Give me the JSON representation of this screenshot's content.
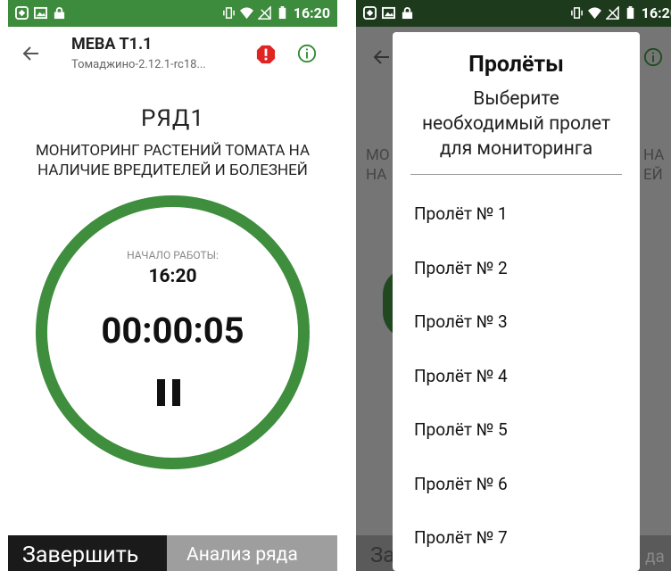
{
  "status_bar": {
    "time": "16:20"
  },
  "app": {
    "title": "МЕВА Т1.1",
    "subtitle": "Томаджино-2.12.1-rc18..."
  },
  "main": {
    "row_title": "РЯД1",
    "description_line1": "МОНИТОРИНГ РАСТЕНИЙ ТОМАТА НА",
    "description_line2": "НАЛИЧИЕ ВРЕДИТЕЛЕЙ И БОЛЕЗНЕЙ",
    "start_label": "НАЧАЛО РАБОТЫ:",
    "start_time": "16:20",
    "elapsed": "00:00:05"
  },
  "bottom_bar": {
    "finish_label": "Завершить",
    "analyze_label": "Анализ ряда"
  },
  "dialog": {
    "title": "Пролёты",
    "message_line1": "Выберите",
    "message_line2": "необходимый пролет",
    "message_line3": "для мониторинга",
    "items": [
      {
        "label": "Пролёт № 1"
      },
      {
        "label": "Пролёт № 2"
      },
      {
        "label": "Пролёт № 3"
      },
      {
        "label": "Пролёт № 4"
      },
      {
        "label": "Пролёт № 5"
      },
      {
        "label": "Пролёт № 6"
      },
      {
        "label": "Пролёт № 7"
      }
    ]
  },
  "background_partial": {
    "left1": "МО",
    "left2": "НА",
    "right1": "НА",
    "right2": "ЕЙ",
    "bottom_left": "За",
    "bottom_right": "да"
  },
  "colors": {
    "status_bar": "#3d8b3d",
    "status_bar_dim": "#1d3a1d",
    "ring": "#3e8e3e",
    "alert": "#e02424",
    "info": "#2e8b2e",
    "finish_button": "#1a1a1a",
    "analyze_button": "#9e9e9e"
  },
  "icons": {
    "back": "arrow-left-icon",
    "alert": "alert-octagon-icon",
    "info": "info-circle-icon",
    "pause": "pause-icon"
  }
}
